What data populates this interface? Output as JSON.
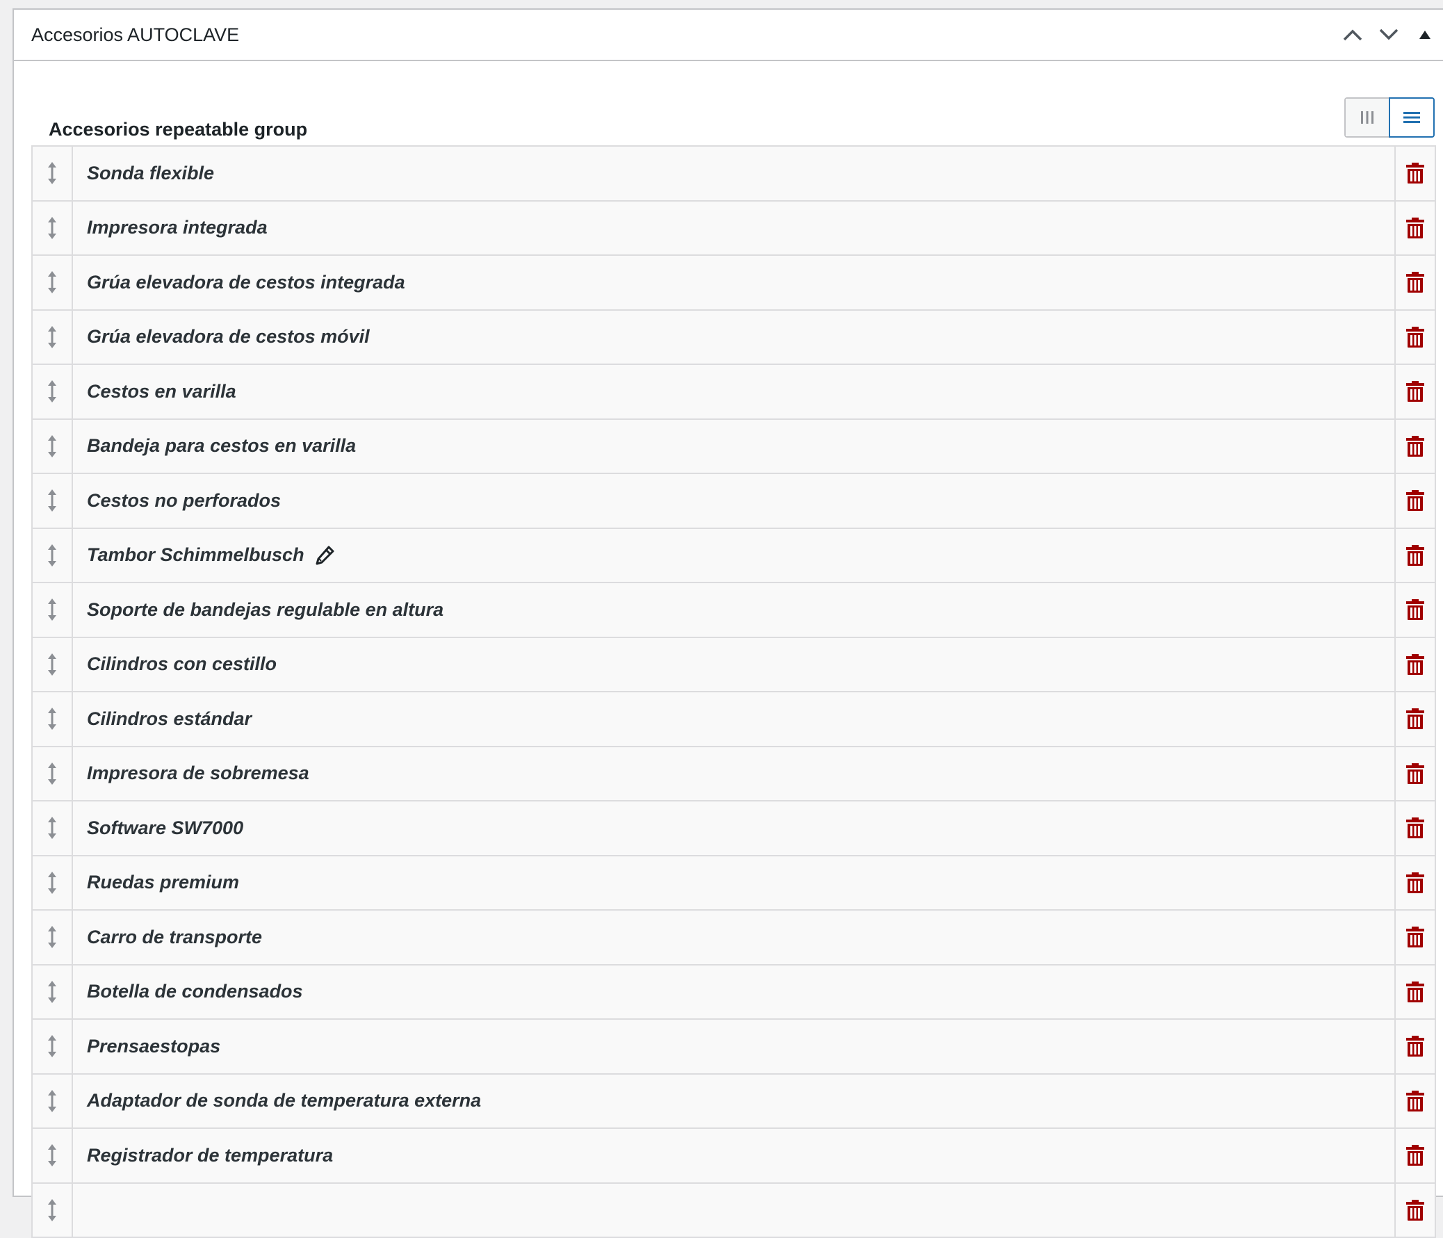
{
  "metabox": {
    "title": "Accesorios AUTOCLAVE",
    "actions": [
      "chevron-up-icon",
      "chevron-down-icon",
      "triangle-up-icon"
    ]
  },
  "group": {
    "label": "Accesorios repeatable group",
    "view_modes": [
      "columns-icon",
      "list-icon"
    ],
    "active_view": "list"
  },
  "colors": {
    "delete": "#a00000",
    "accent": "#2271b1",
    "handle": "#8c8f94"
  },
  "rows": [
    {
      "title": "Sonda flexible"
    },
    {
      "title": "Impresora integrada"
    },
    {
      "title": "Grúa elevadora de cestos integrada"
    },
    {
      "title": "Grúa elevadora de cestos móvil"
    },
    {
      "title": "Cestos en varilla"
    },
    {
      "title": "Bandeja para cestos en varilla"
    },
    {
      "title": "Cestos no perforados"
    },
    {
      "title": "Tambor Schimmelbusch",
      "editing": true
    },
    {
      "title": "Soporte de bandejas regulable en altura"
    },
    {
      "title": "Cilindros con cestillo"
    },
    {
      "title": "Cilindros estándar"
    },
    {
      "title": "Impresora de sobremesa"
    },
    {
      "title": "Software SW7000"
    },
    {
      "title": "Ruedas premium"
    },
    {
      "title": "Carro de transporte"
    },
    {
      "title": "Botella de condensados"
    },
    {
      "title": "Prensaestopas"
    },
    {
      "title": "Adaptador de sonda de temperatura externa"
    },
    {
      "title": "Registrador de temperatura"
    },
    {
      "title": ""
    }
  ]
}
